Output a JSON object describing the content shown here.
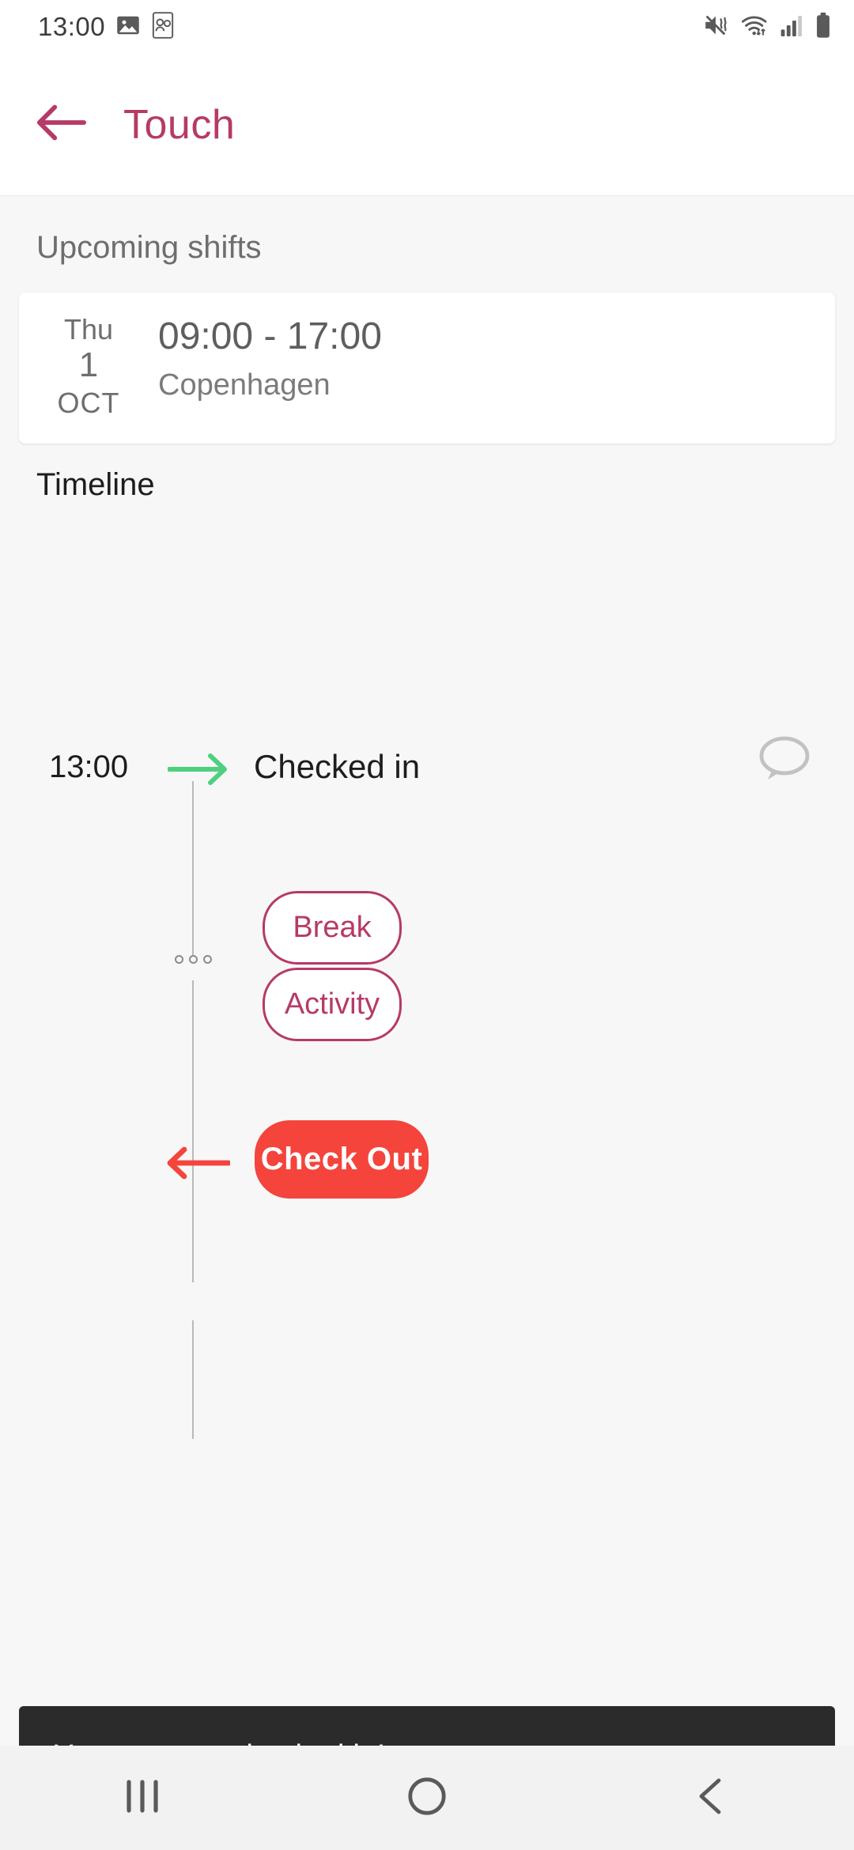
{
  "status_bar": {
    "clock": "13:00",
    "icons_left": [
      "image-icon",
      "contacts-icon"
    ],
    "icons_right": [
      "mute-vibrate-icon",
      "wifi-icon",
      "signal-icon",
      "battery-icon"
    ]
  },
  "app_bar": {
    "back_icon": "back-arrow-icon",
    "title": "Touch",
    "accent_color": "#b63a67"
  },
  "upcoming": {
    "section_label": "Upcoming shifts",
    "shift": {
      "day_of_week": "Thu",
      "day_number": "1",
      "month": "OCT",
      "time_range": "09:00 - 17:00",
      "location": "Copenhagen"
    }
  },
  "timeline": {
    "section_label": "Timeline",
    "check_in": {
      "time": "13:00",
      "label": "Checked in",
      "arrow_icon": "arrow-right-icon",
      "arrow_color": "#4ed07f",
      "note_icon": "chat-bubble-icon"
    },
    "dots_icon": "ellipsis-icon",
    "actions": [
      {
        "label": "Break",
        "name": "break-button"
      },
      {
        "label": "Activity",
        "name": "activity-button"
      }
    ],
    "check_out": {
      "label": "Check Out",
      "color": "#f4443c",
      "arrow_icon": "arrow-left-icon",
      "arrow_color": "#f4443c"
    }
  },
  "snackbar": {
    "message": "You are now checked in!",
    "background": "#2b2b2b"
  },
  "nav_bar": {
    "recents": "recents-icon",
    "home": "home-icon",
    "back": "back-icon"
  }
}
